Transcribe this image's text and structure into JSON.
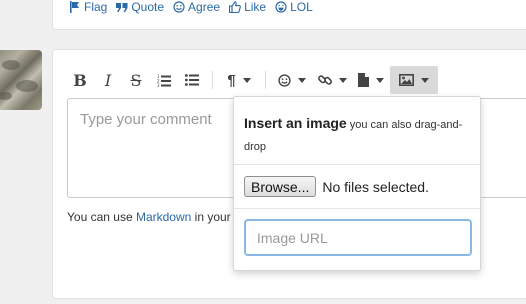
{
  "reactions": [
    {
      "label": "Flag",
      "icon": "flag-icon"
    },
    {
      "label": "Quote",
      "icon": "quote-icon"
    },
    {
      "label": "Agree",
      "icon": "smile-icon"
    },
    {
      "label": "Like",
      "icon": "thumbs-up-icon"
    },
    {
      "label": "LOL",
      "icon": "laugh-icon"
    }
  ],
  "toolbar": {
    "bold": "B",
    "italic": "I",
    "strike": "S"
  },
  "editor": {
    "placeholder": "Type your comment",
    "markdown_prefix": "You can use ",
    "markdown_link": "Markdown",
    "markdown_suffix": " in your p"
  },
  "image_popup": {
    "title": "Insert an image",
    "subtitle": " you can also drag-and-drop",
    "browse_label": "Browse...",
    "file_status": "No files selected.",
    "url_placeholder": "Image URL"
  },
  "colors": {
    "link": "#2b6aa8",
    "active_button": "#d9d9d9",
    "focus_border": "#8ab8e6"
  }
}
